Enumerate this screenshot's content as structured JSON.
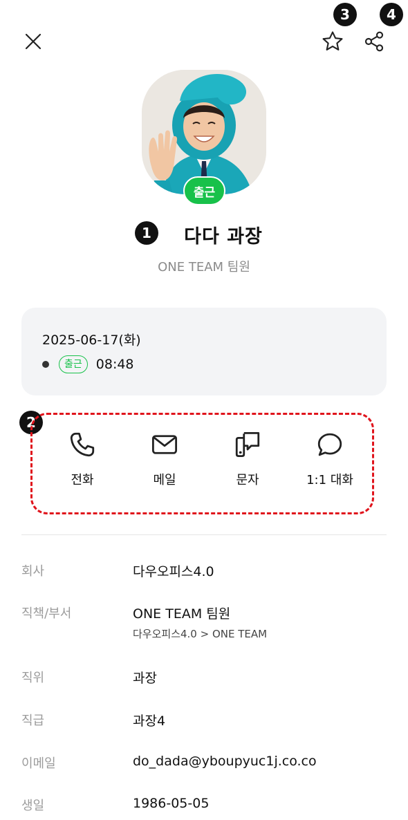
{
  "header": {
    "close_icon": "close-icon",
    "favorite_icon": "star-outline-icon",
    "share_icon": "share-icon"
  },
  "markers": {
    "m1": "1",
    "m2": "2",
    "m3": "3",
    "m4": "4"
  },
  "profile": {
    "name": "다다 과장",
    "team": "ONE TEAM 팀원",
    "status": "출근",
    "status_color": "#18c14a"
  },
  "attendance": {
    "date": "2025-06-17(화)",
    "badge": "출근",
    "time": "08:48"
  },
  "actions": [
    {
      "label": "전화",
      "icon": "phone-icon"
    },
    {
      "label": "메일",
      "icon": "mail-icon"
    },
    {
      "label": "문자",
      "icon": "sms-icon"
    },
    {
      "label": "1:1 대화",
      "icon": "chat-bubble-icon"
    }
  ],
  "details": {
    "company_label": "회사",
    "company_value": "다우오피스4.0",
    "dept_label": "직책/부서",
    "dept_value": "ONE TEAM 팀원",
    "dept_path": "다우오피스4.0 > ONE TEAM",
    "position_label": "직위",
    "position_value": "과장",
    "grade_label": "직급",
    "grade_value": "과장4",
    "email_label": "이메일",
    "email_value": "do_dada@yboupyuc1j.co.co",
    "birthday_label": "생일",
    "birthday_value": "1986-05-05"
  },
  "colors": {
    "accent_green": "#18c14a",
    "highlight_red": "#e0141c",
    "card_bg": "#f3f4f6"
  }
}
